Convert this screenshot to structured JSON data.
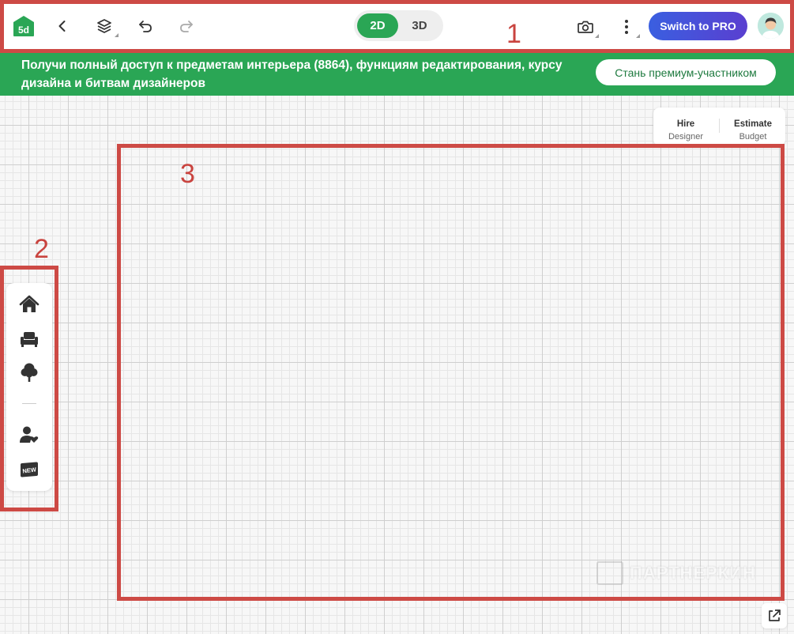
{
  "toolbar": {
    "logo_text": "5d",
    "view_modes": [
      "2D",
      "3D"
    ],
    "active_view": "2D",
    "pro_button_label": "Switch to PRO"
  },
  "banner": {
    "text": "Получи полный доступ к предметам интерьера (8864), функциям редактирования, курсу дизайна и битвам дизайнеров",
    "button_label": "Стань премиум-участником"
  },
  "hire_card": {
    "hire": {
      "title": "Hire",
      "subtitle": "Designer"
    },
    "estimate": {
      "title": "Estimate",
      "subtitle": "Budget"
    }
  },
  "tool_rail": {
    "icons": [
      "home-icon",
      "furniture-icon",
      "tree-icon",
      "user-heart-icon",
      "new-badge-icon"
    ],
    "new_label": "NEW"
  },
  "annotations": {
    "labels": [
      "1",
      "2",
      "3"
    ],
    "color": "#cd4a45"
  },
  "watermark": {
    "text": "ПАРТНЕРКИН"
  },
  "colors": {
    "brand_green": "#2aa655",
    "pro_gradient_start": "#3a5fe0",
    "pro_gradient_end": "#5a3fd0",
    "annotation_red": "#cd4a45"
  }
}
